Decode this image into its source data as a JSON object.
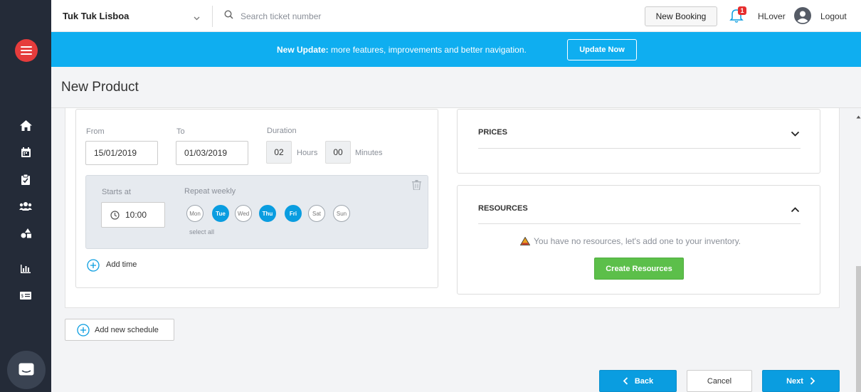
{
  "topbar": {
    "company": "Tuk Tuk Lisboa",
    "search_placeholder": "Search ticket number",
    "new_booking": "New Booking",
    "notification_count": "1",
    "user_name": "HLover",
    "logout": "Logout"
  },
  "banner": {
    "bold": "New Update:",
    "text": " more features, improvements and better navigation.",
    "button": "Update Now"
  },
  "page": {
    "title": "New Product"
  },
  "schedule": {
    "from_label": "From",
    "from_value": "15/01/2019",
    "to_label": "To",
    "to_value": "01/03/2019",
    "duration_label": "Duration",
    "duration_hours": "02",
    "hours_label": "Hours",
    "duration_minutes": "00",
    "minutes_label": "Minutes",
    "starts_label": "Starts at",
    "starts_value": "10:00",
    "repeat_label": "Repeat weekly",
    "days": [
      {
        "label": "Mon",
        "selected": false
      },
      {
        "label": "Tue",
        "selected": true
      },
      {
        "label": "Wed",
        "selected": false
      },
      {
        "label": "Thu",
        "selected": true
      },
      {
        "label": "Fri",
        "selected": true
      },
      {
        "label": "Sat",
        "selected": false
      },
      {
        "label": "Sun",
        "selected": false
      }
    ],
    "select_all": "select all",
    "add_time": "Add time",
    "add_schedule": "Add new schedule"
  },
  "prices": {
    "title": "PRICES"
  },
  "resources": {
    "title": "RESOURCES",
    "empty_text": "You have no resources, let's add one to your inventory.",
    "create_button": "Create Resources"
  },
  "footer": {
    "back": "Back",
    "cancel": "Cancel",
    "next": "Next"
  },
  "colors": {
    "accent": "#0a9de0",
    "banner": "#0faef0",
    "sidebar": "#242b38",
    "logo": "#e63c3c",
    "success": "#5cbf4a"
  },
  "icons": [
    "home-icon",
    "calendar-icon",
    "clipboard-icon",
    "users-icon",
    "shapes-icon",
    "bar-chart-icon",
    "ticket-icon",
    "chat-icon",
    "bell-icon",
    "user-avatar-icon",
    "search-icon",
    "trash-icon",
    "clock-icon",
    "plus-circle-icon",
    "warning-icon"
  ]
}
